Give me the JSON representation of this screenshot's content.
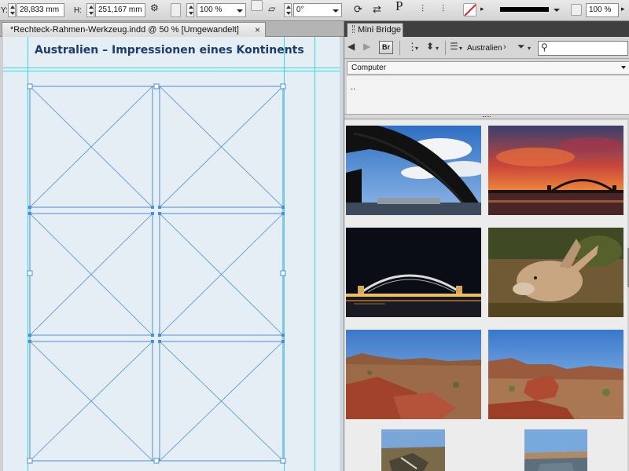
{
  "control_bar": {
    "y_label": "Y:",
    "y_value": "28,833 mm",
    "h_label": "H:",
    "h_value": "251,167 mm",
    "scale_x": "100 %",
    "scale_y": "100 %",
    "angle": "0°",
    "stroke_letter": "P"
  },
  "document": {
    "tab_title": "*Rechteck-Rahmen-Werkzeug.indd @ 50 % [Umgewandelt]",
    "close_glyph": "×",
    "headline": "Australien – Impressionen eines Kontinents",
    "frame_count": 6
  },
  "panel": {
    "tab_label": "Mini Bridge",
    "br_label": "Br",
    "path_label": "Australien",
    "location": "Computer",
    "folder_item": "..",
    "thumbnails": [
      "sydney-harbour-bridge-day",
      "sydney-harbour-bridge-sunset",
      "sydney-harbour-bridge-night",
      "kangaroo",
      "outback-rocks-1",
      "outback-rocks-2",
      "outback-portrait-1",
      "outback-portrait-2"
    ]
  },
  "colors": {
    "guide": "#37d7e6",
    "frame": "#4b8fd6",
    "headline": "#1a3c6e",
    "page": "#e5eef5"
  }
}
